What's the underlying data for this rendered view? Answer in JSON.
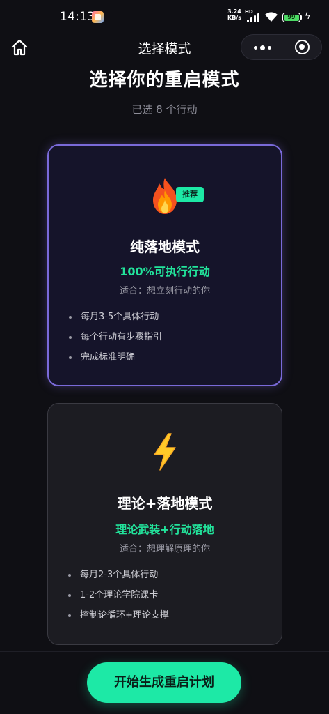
{
  "status_bar": {
    "time": "14:13",
    "net_speed_value": "3.24",
    "net_speed_unit": "KB/s",
    "network_tag": "HD",
    "battery_level": "99",
    "charging_icon": "charging-bolt-icon"
  },
  "nav": {
    "title": "选择模式",
    "home_icon": "home-icon",
    "more_icon": "more-dots-icon",
    "close_icon": "miniprogram-close-icon"
  },
  "header": {
    "title": "选择你的重启模式",
    "selected_text": "已选 8 个行动"
  },
  "modes": [
    {
      "icon": "fire-icon",
      "badge": "推荐",
      "title": "纯落地模式",
      "subtitle": "100%可执行行动",
      "fit": "适合：想立刻行动的你",
      "features": [
        "每月3-5个具体行动",
        "每个行动有步骤指引",
        "完成标准明确"
      ],
      "selected": true
    },
    {
      "icon": "lightning-icon",
      "title": "理论+落地模式",
      "subtitle": "理论武装+行动落地",
      "fit": "适合：想理解原理的你",
      "features": [
        "每月2-3个具体行动",
        "1-2个理论学院课卡",
        "控制论循环+理论支撑"
      ],
      "selected": false
    }
  ],
  "cta": {
    "label": "开始生成重启计划"
  },
  "colors": {
    "background": "#0f0f14",
    "accent_green": "#1de9a6",
    "selected_border": "#7a6ad9",
    "subtitle_green": "#22e39b"
  }
}
